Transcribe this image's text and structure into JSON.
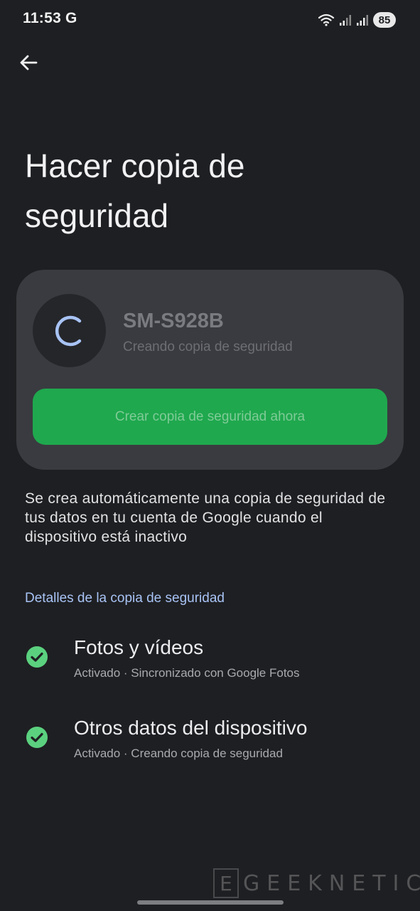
{
  "status_bar": {
    "time": "11:53",
    "g_icon": "G",
    "battery": "85",
    "icons": [
      "wifi-icon",
      "signal-icon",
      "signal-icon",
      "battery-icon"
    ]
  },
  "header": {
    "back_icon": "arrow-left-icon",
    "title": "Hacer copia de seguridad"
  },
  "card": {
    "device_name": "SM-S928B",
    "device_status": "Creando copia de seguridad",
    "button_label": "Crear copia de seguridad ahora",
    "spinner_icon": "progress-spinner-icon"
  },
  "description": "Se crea automáticamente una copia de seguridad de tus datos en tu cuenta de Google cuando el dispositivo está inactivo",
  "details": {
    "header": "Detalles de la copia de seguridad",
    "items": [
      {
        "title": "Fotos y vídeos",
        "subtitle": "Activado · Sincronizado con Google Fotos",
        "icon": "check-circle-icon"
      },
      {
        "title": "Otros datos del dispositivo",
        "subtitle": "Activado · Creando copia de seguridad",
        "icon": "check-circle-icon"
      }
    ]
  },
  "watermark": {
    "letter": "E",
    "text": "GEEKNETIC"
  },
  "colors": {
    "background": "#1e1f22",
    "card": "#3a3b40",
    "button": "#1fa84e",
    "check": "#5bd17f",
    "link": "#a8c3f5"
  }
}
